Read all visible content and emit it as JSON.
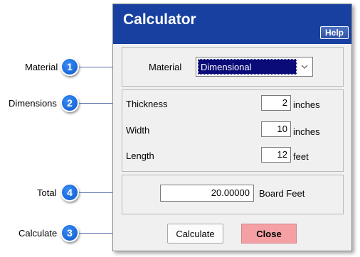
{
  "callouts": [
    {
      "num": "1",
      "label": "Material"
    },
    {
      "num": "2",
      "label": "Dimensions"
    },
    {
      "num": "4",
      "label": "Total"
    },
    {
      "num": "3",
      "label": "Calculate"
    }
  ],
  "dialog": {
    "title": "Calculator",
    "help_label": "Help",
    "material": {
      "label": "Material",
      "selected": "Dimensional"
    },
    "dimensions": [
      {
        "label": "Thickness",
        "value": "2",
        "unit": "inches"
      },
      {
        "label": "Width",
        "value": "10",
        "unit": "inches"
      },
      {
        "label": "Length",
        "value": "12",
        "unit": "feet"
      }
    ],
    "total": {
      "value": "20.00000",
      "unit": "Board Feet"
    },
    "buttons": {
      "calculate": "Calculate",
      "close": "Close"
    }
  },
  "colors": {
    "titlebar": "#1740a0",
    "badge": "#1f6fe0",
    "close_button": "#f4a0a4",
    "select_highlight": "#0a0a78"
  }
}
